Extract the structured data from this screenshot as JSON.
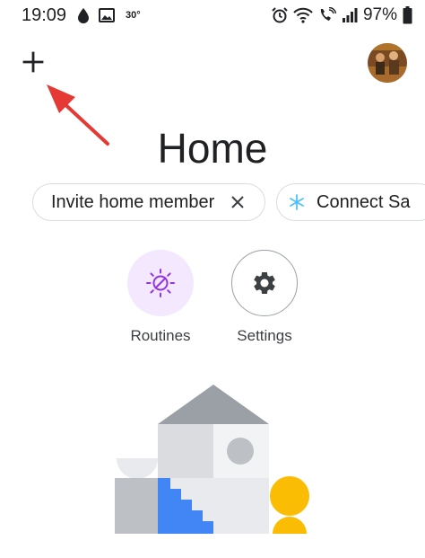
{
  "status_bar": {
    "time": "19:09",
    "temperature": "30°",
    "battery": "97%",
    "icons_left": [
      "water-drop-icon",
      "gallery-icon"
    ],
    "icons_right": [
      "alarm-icon",
      "wifi-icon",
      "wifi-calling-icon",
      "signal-icon",
      "battery-icon"
    ]
  },
  "header": {
    "title": "Home",
    "add_icon": "plus-icon"
  },
  "chips": [
    {
      "label": "Invite home member",
      "icon": "close-icon"
    },
    {
      "label": "Connect Sa",
      "icon": "snowflake-icon"
    }
  ],
  "actions": [
    {
      "label": "Routines",
      "icon": "routines-sun-icon"
    },
    {
      "label": "Settings",
      "icon": "gear-icon"
    }
  ],
  "colors": {
    "routines_bg": "#f3e8fd",
    "routines_icon": "#9334e6",
    "accent_blue": "#4285f4",
    "accent_yellow": "#fbbc04",
    "arrow_red": "#e53935",
    "snowflake": "#4fc3f7"
  }
}
